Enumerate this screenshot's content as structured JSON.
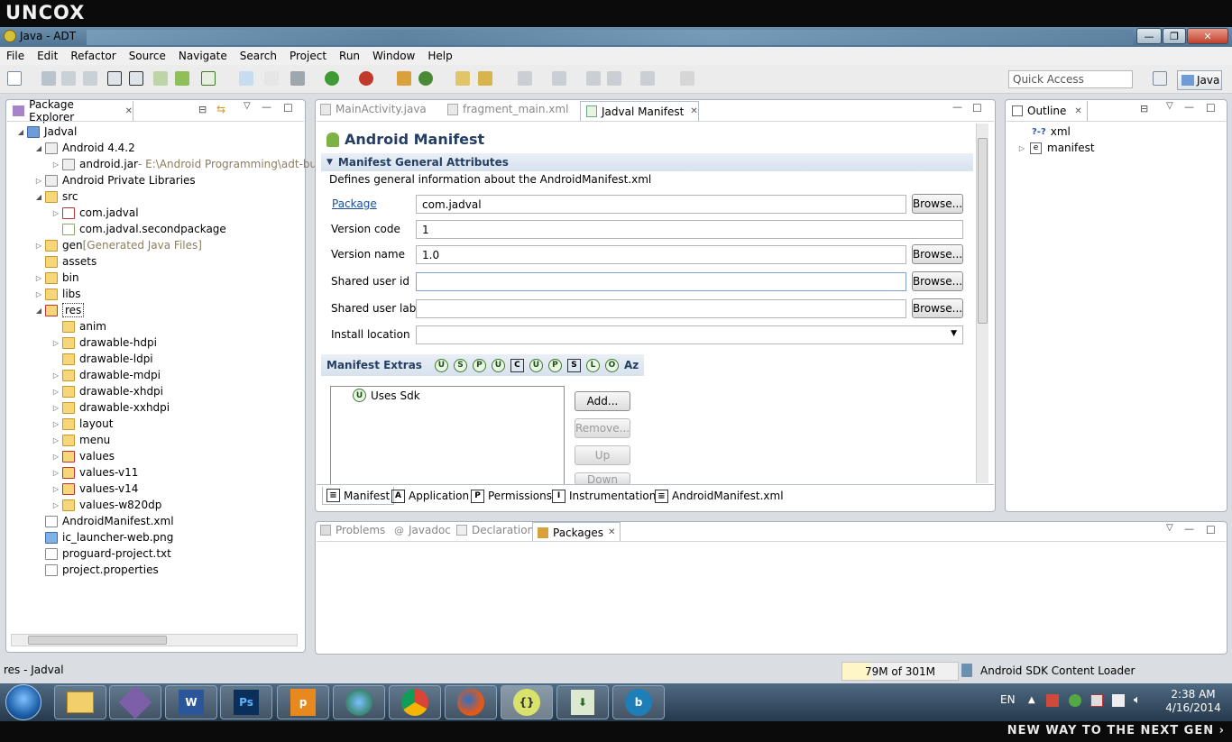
{
  "brand": "UNCOX",
  "window": {
    "title": "Java - ADT"
  },
  "menubar": [
    "File",
    "Edit",
    "Refactor",
    "Source",
    "Navigate",
    "Search",
    "Project",
    "Run",
    "Window",
    "Help"
  ],
  "toolbar": {
    "quick_access": "Quick Access",
    "perspective": "Java"
  },
  "package_explorer": {
    "tab_label": "Package Explorer",
    "rows": [
      {
        "label": "Jadval",
        "suffix": ""
      },
      {
        "label": "Android 4.4.2",
        "suffix": ""
      },
      {
        "label": "android.jar",
        "suffix": " - E:\\Android Programming\\adt-bu"
      },
      {
        "label": "Android Private Libraries",
        "suffix": ""
      },
      {
        "label": "src",
        "suffix": ""
      },
      {
        "label": "com.jadval",
        "suffix": ""
      },
      {
        "label": "com.jadval.secondpackage",
        "suffix": ""
      },
      {
        "label": "gen",
        "suffix": " [Generated Java Files]"
      },
      {
        "label": "assets",
        "suffix": ""
      },
      {
        "label": "bin",
        "suffix": ""
      },
      {
        "label": "libs",
        "suffix": ""
      },
      {
        "label": "res",
        "suffix": ""
      },
      {
        "label": "anim",
        "suffix": ""
      },
      {
        "label": "drawable-hdpi",
        "suffix": ""
      },
      {
        "label": "drawable-ldpi",
        "suffix": ""
      },
      {
        "label": "drawable-mdpi",
        "suffix": ""
      },
      {
        "label": "drawable-xhdpi",
        "suffix": ""
      },
      {
        "label": "drawable-xxhdpi",
        "suffix": ""
      },
      {
        "label": "layout",
        "suffix": ""
      },
      {
        "label": "menu",
        "suffix": ""
      },
      {
        "label": "values",
        "suffix": ""
      },
      {
        "label": "values-v11",
        "suffix": ""
      },
      {
        "label": "values-v14",
        "suffix": ""
      },
      {
        "label": "values-w820dp",
        "suffix": ""
      },
      {
        "label": "AndroidManifest.xml",
        "suffix": ""
      },
      {
        "label": "ic_launcher-web.png",
        "suffix": ""
      },
      {
        "label": "proguard-project.txt",
        "suffix": ""
      },
      {
        "label": "project.properties",
        "suffix": ""
      }
    ]
  },
  "editor": {
    "tabs": [
      "MainActivity.java",
      "fragment_main.xml",
      "Jadval Manifest"
    ],
    "title": "Android Manifest",
    "section_title": "Manifest General Attributes",
    "section_desc": "Defines general information about the AndroidManifest.xml",
    "fields": {
      "package_label": "Package",
      "package_value": "com.jadval",
      "version_code_label": "Version code",
      "version_code_value": "1",
      "version_name_label": "Version name",
      "version_name_value": "1.0",
      "shared_user_id_label": "Shared user id",
      "shared_user_id_value": "",
      "shared_user_label_label": "Shared user label",
      "shared_user_label_value": "",
      "install_location_label": "Install location",
      "install_location_value": ""
    },
    "browse_label": "Browse...",
    "extras_title": "Manifest Extras",
    "extras_icons": [
      "U",
      "S",
      "P",
      "U",
      "C",
      "U",
      "P",
      "S",
      "L",
      "O"
    ],
    "extras_sort": "Az",
    "extras_item": "Uses Sdk",
    "buttons": {
      "add": "Add...",
      "remove": "Remove...",
      "up": "Up",
      "down": "Down"
    },
    "bottom_tabs": [
      {
        "icon": "≡",
        "label": "Manifest"
      },
      {
        "icon": "A",
        "label": "Application"
      },
      {
        "icon": "P",
        "label": "Permissions"
      },
      {
        "icon": "I",
        "label": "Instrumentation"
      },
      {
        "icon": "≡",
        "label": "AndroidManifest.xml"
      }
    ]
  },
  "outline": {
    "tab_label": "Outline",
    "items": [
      {
        "icon": "?-?",
        "label": "xml"
      },
      {
        "icon": "e",
        "label": "manifest"
      }
    ]
  },
  "bottom_panel": {
    "tabs": [
      "Problems",
      "Javadoc",
      "Declaration",
      "Packages"
    ]
  },
  "status": {
    "left": "res - Jadval",
    "memory": "79M of 301M",
    "right": "Android SDK Content Loader"
  },
  "taskbar": {
    "lang": "EN",
    "time": "2:38 AM",
    "date": "4/16/2014"
  },
  "footer_text": "NEW WAY TO THE NEXT GEN ›"
}
